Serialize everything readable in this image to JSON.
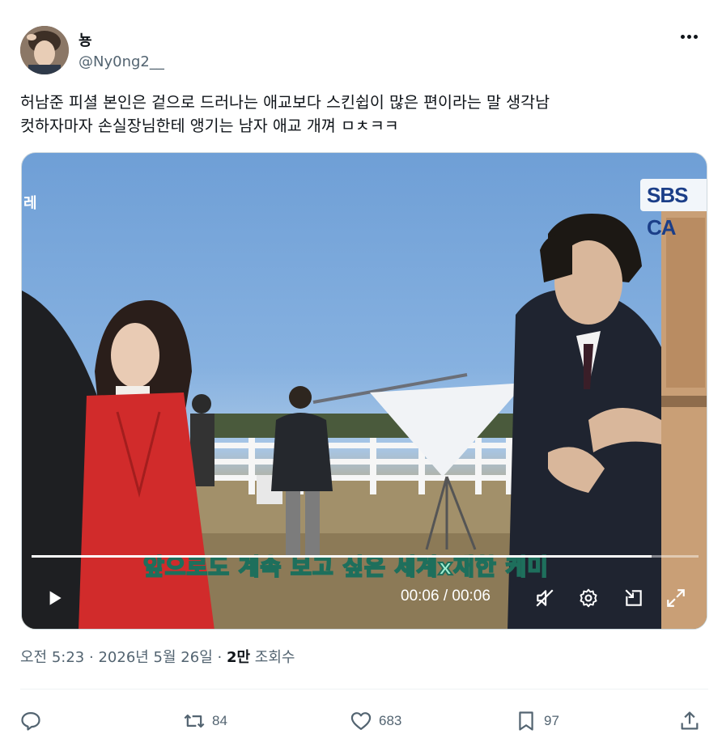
{
  "author": {
    "display_name": "뇽",
    "handle": "@Ny0ng2__"
  },
  "tweet": {
    "text": "허남준 피셜 본인은 겉으로 드러나는 애교보다 스킨쉽이 많은 편이라는 말 생각남\n컷하자마자 손실장님한테 앵기는 남자 애교 개껴 ㅁㅊㅋㅋ"
  },
  "video": {
    "subtitle": "앞으로도 계속 보고 싶은 세계x재한 케미",
    "broadcaster_logo": "SBS CA",
    "left_mark": "레",
    "time_display": "00:06 / 00:06",
    "progress": 0.93,
    "icons": {
      "play": "play-icon",
      "mute": "volume-muted-icon",
      "settings": "gear-icon",
      "pip": "picture-in-picture-icon",
      "fullscreen": "fullscreen-icon"
    }
  },
  "meta": {
    "time": "오전 5:23",
    "sep1": "·",
    "date": "2026년 5월 26일",
    "sep2": "·",
    "views_count": "2만",
    "views_label": "조회수"
  },
  "actions": {
    "reply": {
      "icon": "reply-icon",
      "count": ""
    },
    "retweet": {
      "icon": "retweet-icon",
      "count": "84"
    },
    "like": {
      "icon": "heart-icon",
      "count": "683"
    },
    "bookmark": {
      "icon": "bookmark-icon",
      "count": "97"
    },
    "share": {
      "icon": "share-icon",
      "count": ""
    }
  },
  "colors": {
    "text_primary": "#0f1419",
    "text_secondary": "#536471",
    "subtitle_fill": "#9ff0d4",
    "subtitle_stroke": "#1e6f5c"
  }
}
